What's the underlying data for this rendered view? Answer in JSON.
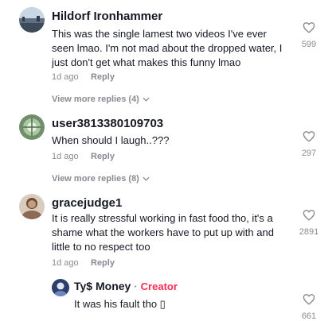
{
  "comments": [
    {
      "username": "Hildorf Ironhammer",
      "text": "This was the single lamest two videos I've ever seen lmao. I'm not mad about the dropped water, I just don't get what makes this funny lmao",
      "age": "1d ago",
      "reply_label": "Reply",
      "likes": "599",
      "more_replies": "View more replies (4)"
    },
    {
      "username": "user3813380109703",
      "text": "When should I laugh..???",
      "age": "1d ago",
      "reply_label": "Reply",
      "likes": "297",
      "more_replies": "View more replies (8)"
    },
    {
      "username": "gracejudge1",
      "text": "It is really stressful working in fast food tho, it's a shame what the workers have to put up with and little to no respect too",
      "age": "1d ago",
      "reply_label": "Reply",
      "likes": "2891"
    }
  ],
  "reply": {
    "username": "Ty$ Money",
    "separator": "·",
    "badge": "Creator",
    "text": "It was his fault tho ▯",
    "likes": "661"
  },
  "colors": {
    "accent": "#fe2c55",
    "muted": "#8a8b91"
  },
  "icons": {
    "like": "heart-outline-icon",
    "expand": "chevron-down-icon"
  }
}
